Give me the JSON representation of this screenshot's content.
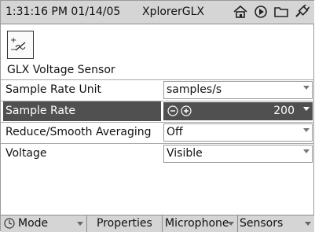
{
  "status": {
    "time": "1:31:16 PM",
    "date": "01/14/05",
    "app_name": "XplorerGLX",
    "icons": [
      "home-icon",
      "play-icon",
      "folder-icon",
      "plug-icon"
    ]
  },
  "sensor": {
    "name": "GLX Voltage Sensor",
    "icon": "voltage-sensor-icon"
  },
  "properties": [
    {
      "label": "Sample Rate Unit",
      "value": "samples/s"
    },
    {
      "label": "Sample Rate",
      "value": "200"
    },
    {
      "label": "Reduce/Smooth Averaging",
      "value": "Off"
    },
    {
      "label": "Voltage",
      "value": "Visible"
    }
  ],
  "bottom_tabs": [
    {
      "label": "Mode"
    },
    {
      "label": "Properties"
    },
    {
      "label": "Microphone"
    },
    {
      "label": "Sensors"
    }
  ]
}
